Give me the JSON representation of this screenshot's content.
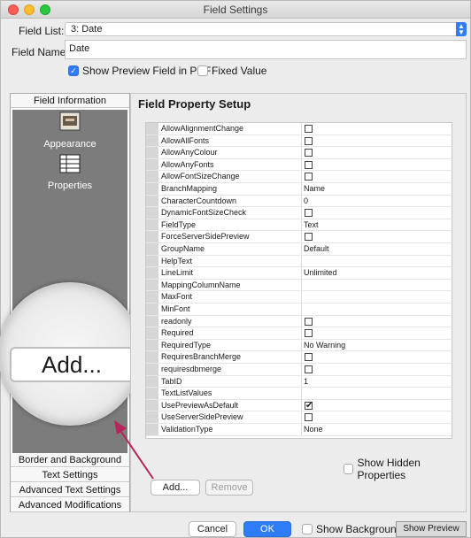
{
  "window": {
    "title": "Field Settings"
  },
  "form": {
    "field_list_label": "Field List:",
    "field_list_value": "3: Date",
    "field_name_label": "Field Name:",
    "field_name_value": "Date",
    "show_preview_label": "Show Preview Field in PDF",
    "show_preview_checked": true,
    "fixed_value_label": "Fixed Value",
    "fixed_value_checked": false
  },
  "sidebar": {
    "top_tab": "Field Information",
    "icons": [
      {
        "label": "Appearance",
        "icon": "appearance-icon"
      },
      {
        "label": "Properties",
        "icon": "properties-icon"
      }
    ],
    "bottom_tabs": [
      "Border and Background",
      "Text Settings",
      "Advanced Text Settings",
      "Advanced Modifications"
    ]
  },
  "magnifier": {
    "label": "Add..."
  },
  "properties": {
    "title": "Field Property Setup",
    "rows": [
      {
        "key": "AllowAlignmentChange",
        "type": "checkbox",
        "checked": false
      },
      {
        "key": "AllowAllFonts",
        "type": "checkbox",
        "checked": false
      },
      {
        "key": "AllowAnyColour",
        "type": "checkbox",
        "checked": false
      },
      {
        "key": "AllowAnyFonts",
        "type": "checkbox",
        "checked": false
      },
      {
        "key": "AllowFontSizeChange",
        "type": "checkbox",
        "checked": false
      },
      {
        "key": "BranchMapping",
        "type": "text",
        "value": "Name"
      },
      {
        "key": "CharacterCountdown",
        "type": "text",
        "value": "0"
      },
      {
        "key": "DynamicFontSizeCheck",
        "type": "checkbox",
        "checked": false
      },
      {
        "key": "FieldType",
        "type": "text",
        "value": "Text"
      },
      {
        "key": "ForceServerSidePreview",
        "type": "checkbox",
        "checked": false
      },
      {
        "key": "GroupName",
        "type": "text",
        "value": "Default"
      },
      {
        "key": "HelpText",
        "type": "text",
        "value": ""
      },
      {
        "key": "LineLimit",
        "type": "text",
        "value": "Unlimited"
      },
      {
        "key": "MappingColumnName",
        "type": "text",
        "value": ""
      },
      {
        "key": "MaxFont",
        "type": "text",
        "value": ""
      },
      {
        "key": "MinFont",
        "type": "text",
        "value": ""
      },
      {
        "key": "readonly",
        "type": "checkbox",
        "checked": false
      },
      {
        "key": "Required",
        "type": "checkbox",
        "checked": false
      },
      {
        "key": "RequiredType",
        "type": "text",
        "value": "No Warning"
      },
      {
        "key": "RequiresBranchMerge",
        "type": "checkbox",
        "checked": false
      },
      {
        "key": "requiresdbmerge",
        "type": "checkbox",
        "checked": false
      },
      {
        "key": "TabID",
        "type": "text",
        "value": "1"
      },
      {
        "key": "TextListValues",
        "type": "text",
        "value": ""
      },
      {
        "key": "UsePreviewAsDefault",
        "type": "checkbox",
        "checked": true
      },
      {
        "key": "UseServerSidePreview",
        "type": "checkbox",
        "checked": false
      },
      {
        "key": "ValidationType",
        "type": "text",
        "value": "None"
      }
    ],
    "show_hidden_label": "Show Hidden Properties",
    "add_label": "Add...",
    "remove_label": "Remove"
  },
  "footer": {
    "cancel_label": "Cancel",
    "ok_label": "OK",
    "show_background_label": "Show Background",
    "show_preview_label": "Show Preview"
  },
  "colors": {
    "accent": "#2e7cf6",
    "arrow": "#b8245a",
    "sidebar_bg": "#7c7c7c"
  }
}
